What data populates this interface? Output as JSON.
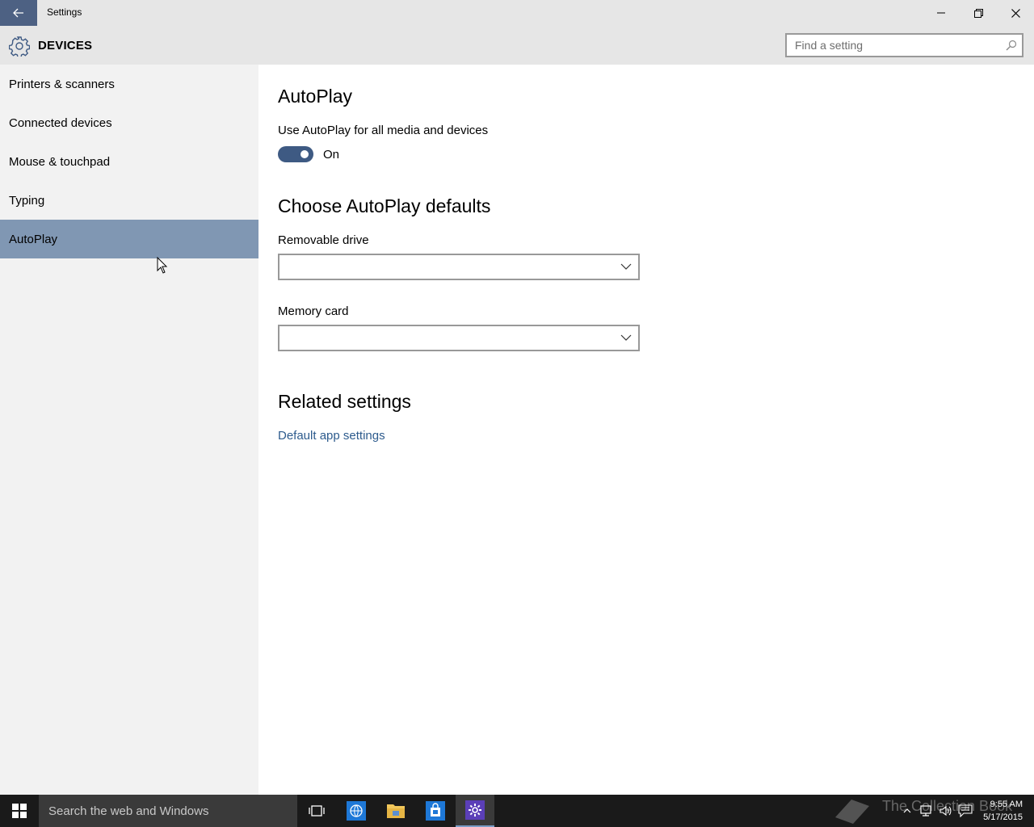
{
  "window": {
    "title": "Settings"
  },
  "header": {
    "title": "DEVICES",
    "search_placeholder": "Find a setting"
  },
  "sidebar": {
    "items": [
      {
        "label": "Printers & scanners",
        "selected": false
      },
      {
        "label": "Connected devices",
        "selected": false
      },
      {
        "label": "Mouse & touchpad",
        "selected": false
      },
      {
        "label": "Typing",
        "selected": false
      },
      {
        "label": "AutoPlay",
        "selected": true
      }
    ]
  },
  "main": {
    "title": "AutoPlay",
    "autoplay_label": "Use AutoPlay for all media and devices",
    "toggle_state": "On",
    "defaults_title": "Choose AutoPlay defaults",
    "removable_label": "Removable drive",
    "removable_value": "",
    "memory_label": "Memory card",
    "memory_value": "",
    "related_title": "Related settings",
    "related_link": "Default app settings"
  },
  "taskbar": {
    "search_text": "Search the web and Windows",
    "watermark": "The Collection Book",
    "time": "9:55 AM",
    "date": "5/17/2015"
  },
  "colors": {
    "accent": "#4d6183",
    "selected_nav": "#8097b3",
    "toggle_on": "#3e5a83",
    "link": "#2d5b8d"
  }
}
